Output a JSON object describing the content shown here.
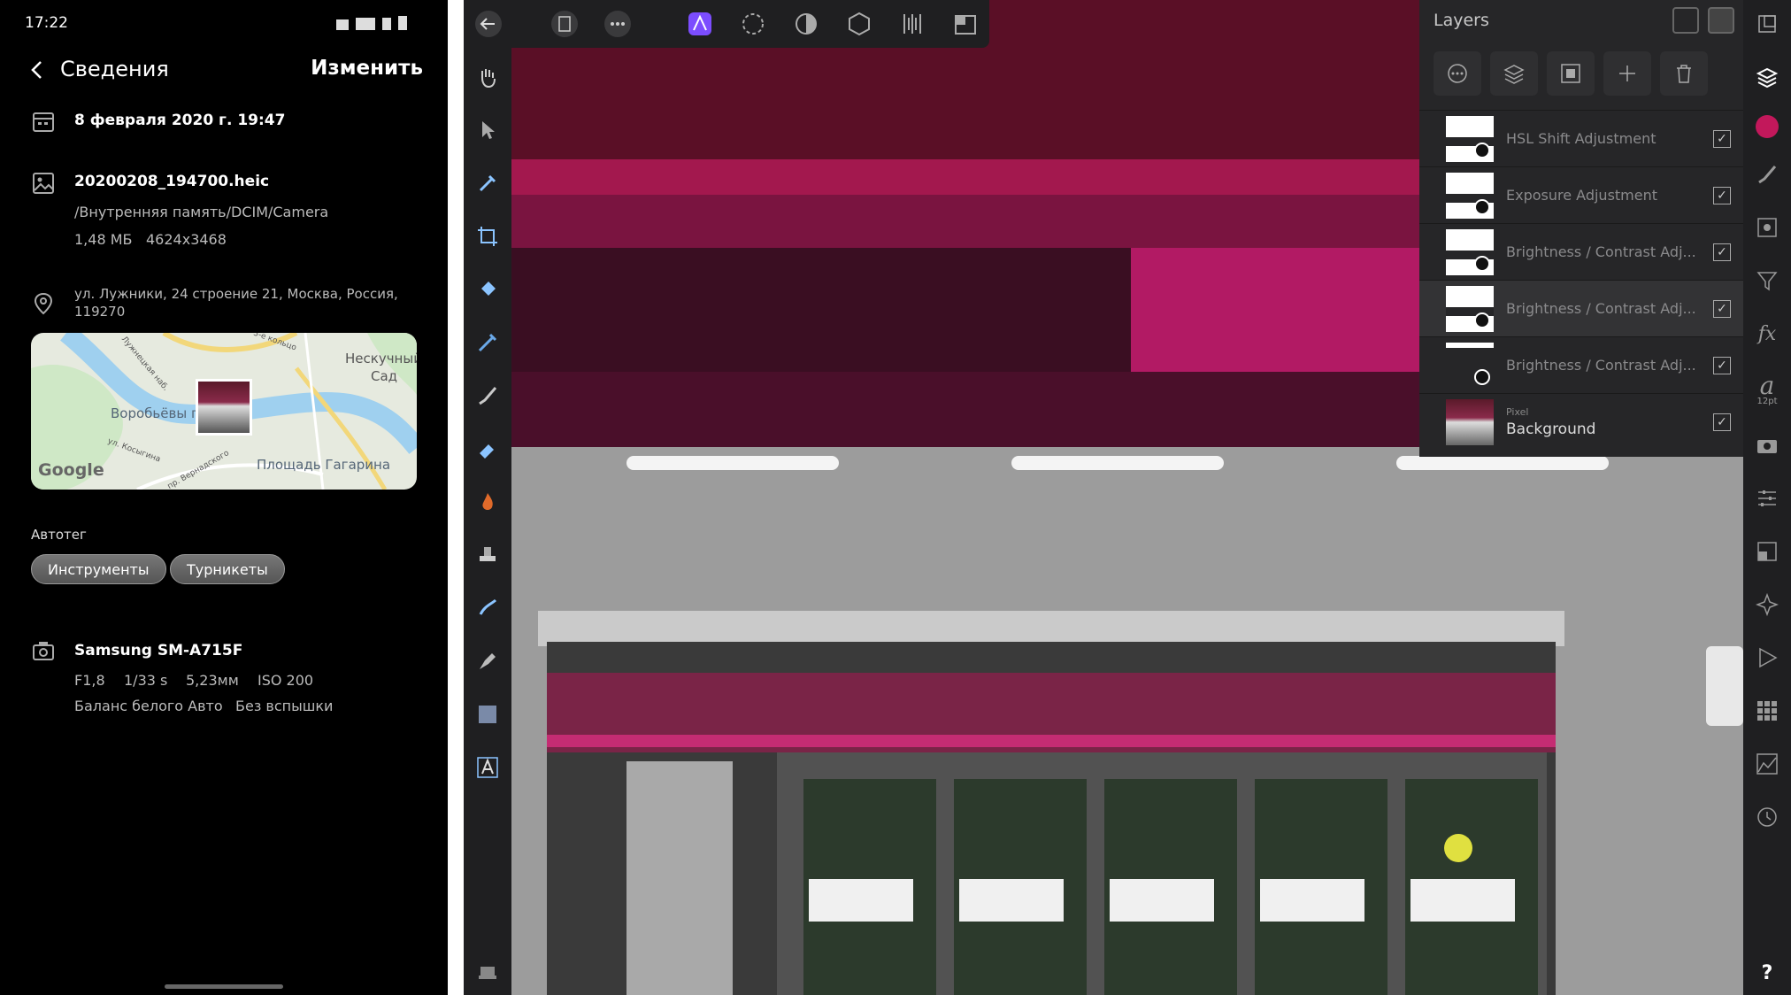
{
  "status": {
    "time": "17:22"
  },
  "header": {
    "title": "Сведения",
    "edit": "Изменить"
  },
  "datetime": "8 февраля 2020 г. 19:47",
  "file": {
    "name": "20200208_194700.heic",
    "path": "/Внутренняя память/DCIM/Camera",
    "size": "1,48 МБ",
    "resolution": "4624x3468"
  },
  "location": {
    "line1": "ул. Лужники, 24 строение 21, Москва, Россия,",
    "line2": "119270"
  },
  "map": {
    "labels": [
      "Нескучный",
      "Сад",
      "Воробьёвы г",
      "Площадь Гагарина",
      "Google",
      "3-е кольцо",
      "Лужнецкая наб.",
      "пр. Вернадского",
      "ул. Косыгина"
    ]
  },
  "autotag": {
    "label": "Автотег",
    "tags": [
      "Инструменты",
      "Турникеты"
    ]
  },
  "camera": {
    "model": "Samsung SM-A715F",
    "aperture": "F1,8",
    "shutter": "1/33 s",
    "focal": "5,23мм",
    "iso": "ISO 200",
    "wb": "Баланс белого Авто",
    "flash": "Без вспышки"
  },
  "layers": {
    "title": "Layers",
    "items": [
      {
        "name": "HSL Shift Adjustment",
        "sub": ""
      },
      {
        "name": "Exposure Adjustment",
        "sub": ""
      },
      {
        "name": "Brightness / Contrast Adj...",
        "sub": ""
      },
      {
        "name": "Brightness / Contrast Adj...",
        "sub": ""
      },
      {
        "name": "Brightness / Contrast Adj...",
        "sub": ""
      },
      {
        "name": "Background",
        "sub": "Pixel"
      }
    ]
  },
  "rightbar": {
    "font_size": "12pt"
  },
  "colors": {
    "accent": "#c2185b",
    "persona": "#7c4dff",
    "panel": "#262628",
    "toolbar": "#1f1f21"
  }
}
